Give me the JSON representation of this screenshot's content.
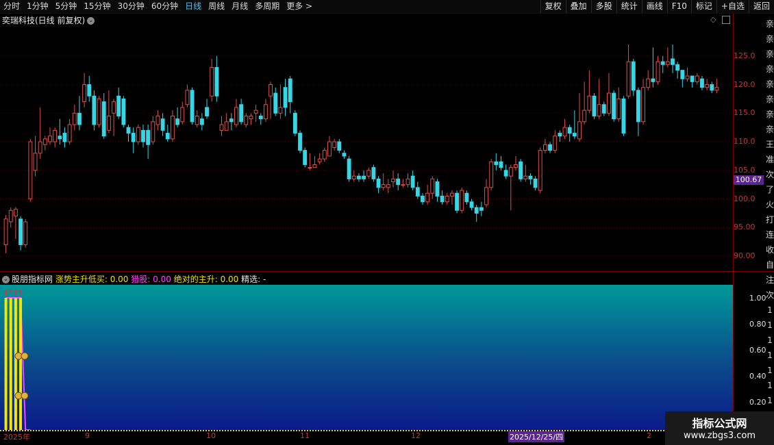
{
  "toolbar": {
    "periods": [
      "分时",
      "1分钟",
      "5分钟",
      "15分钟",
      "30分钟",
      "60分钟",
      "日线",
      "周线",
      "月线",
      "多周期",
      "更多 >"
    ],
    "active_period": "日线",
    "tools": [
      "复权",
      "叠加",
      "多股",
      "统计",
      "画线",
      "F10",
      "标记",
      "+自选",
      "返回"
    ]
  },
  "chart_title": "奕瑞科技(日线 前复权)",
  "price_axis": [
    "125.0",
    "120.0",
    "115.0",
    "110.0",
    "105.0",
    "100.0",
    "95.00",
    "90.00"
  ],
  "current_price": "100.67",
  "indicator": {
    "name": "股朋指标网",
    "f1_label": "涨势主升低买:",
    "f1_value": "0.00",
    "f2_label": "猎股:",
    "f2_value": "0.00",
    "f3_label": "绝对的主升:",
    "f3_value": "0.00",
    "f4_label": "精选:",
    "f4_value": "-",
    "axis": [
      "1.00",
      "0.80",
      "0.60",
      "0.40",
      "0.20"
    ]
  },
  "x_axis": [
    "2025年",
    "9",
    "10",
    "11",
    "12",
    "2"
  ],
  "current_date": "2025/12/25/四",
  "watermark": {
    "title": "指标公式网",
    "url": "www.zbgs3.com"
  },
  "colors": {
    "up": "#e0504a",
    "down": "#35d6e6",
    "axis": "#c03a3a",
    "highlight": "#5a2590"
  },
  "right_strip": [
    "亲",
    "亲",
    "亲",
    "亲",
    "亲",
    "亲",
    "亲",
    "亲",
    "王",
    "准",
    "次",
    "了",
    "火",
    "打",
    "连",
    "收",
    "自",
    "注",
    "次",
    "1",
    "1",
    "1",
    "1",
    "1",
    "1",
    "1",
    "1"
  ],
  "chart_data": {
    "type": "candlestick",
    "ylim": [
      87.5,
      130
    ],
    "candles": [
      [
        92.0,
        96.5,
        90.5,
        97.2
      ],
      [
        96.0,
        98.0,
        95.0,
        98.5
      ],
      [
        97.0,
        98.2,
        93.0,
        98.6
      ],
      [
        96.5,
        92.0,
        91.0,
        97.0
      ],
      [
        92.0,
        96.0,
        91.5,
        96.5
      ],
      [
        100.0,
        110.0,
        99.5,
        110.5
      ],
      [
        105.0,
        108.0,
        104.0,
        111.0
      ],
      [
        108.0,
        110.0,
        107.0,
        116.0
      ],
      [
        109.5,
        110.5,
        108.5,
        111.0
      ],
      [
        110.0,
        111.0,
        109.5,
        112.5
      ],
      [
        110.0,
        112.0,
        109.0,
        112.5
      ],
      [
        111.0,
        110.5,
        109.5,
        114.0
      ],
      [
        111.5,
        110.0,
        109.0,
        112.5
      ],
      [
        110.0,
        113.0,
        109.5,
        114.0
      ],
      [
        113.0,
        115.0,
        112.0,
        116.5
      ],
      [
        115.0,
        113.0,
        112.0,
        118.0
      ],
      [
        117.0,
        120.0,
        116.0,
        122.0
      ],
      [
        120.0,
        118.0,
        117.0,
        121.5
      ],
      [
        118.0,
        113.0,
        112.0,
        119.0
      ],
      [
        113.0,
        117.5,
        112.5,
        118.0
      ],
      [
        117.0,
        111.0,
        110.5,
        118.5
      ],
      [
        112.0,
        114.5,
        111.5,
        119.0
      ],
      [
        115.0,
        117.0,
        111.0,
        117.5
      ],
      [
        118.0,
        114.5,
        114.0,
        119.5
      ],
      [
        117.5,
        113.0,
        112.5,
        118.0
      ],
      [
        112.5,
        111.5,
        110.0,
        113.0
      ],
      [
        111.5,
        110.0,
        108.0,
        112.5
      ],
      [
        110.0,
        112.5,
        109.5,
        113.0
      ],
      [
        112.0,
        110.0,
        109.0,
        113.0
      ],
      [
        112.0,
        109.5,
        107.0,
        113.0
      ],
      [
        110.0,
        113.5,
        109.5,
        114.5
      ],
      [
        113.0,
        114.5,
        112.0,
        115.5
      ],
      [
        114.0,
        112.0,
        111.0,
        115.0
      ],
      [
        111.5,
        110.5,
        110.0,
        113.0
      ],
      [
        110.5,
        114.5,
        110.0,
        115.5
      ],
      [
        114.0,
        113.0,
        112.5,
        116.0
      ],
      [
        113.5,
        116.0,
        113.0,
        117.0
      ],
      [
        116.5,
        119.0,
        116.0,
        120.0
      ],
      [
        119.0,
        113.5,
        113.0,
        119.5
      ],
      [
        113.0,
        114.5,
        112.5,
        115.5
      ],
      [
        114.0,
        113.0,
        112.0,
        115.0
      ],
      [
        116.0,
        114.5,
        114.0,
        117.5
      ],
      [
        118.0,
        123.0,
        117.0,
        124.5
      ],
      [
        123.0,
        118.0,
        117.0,
        125.0
      ],
      [
        112.0,
        113.0,
        111.0,
        114.5
      ],
      [
        112.0,
        113.5,
        112.0,
        115.0
      ],
      [
        114.0,
        113.5,
        112.0,
        115.0
      ],
      [
        113.0,
        116.0,
        112.5,
        117.5
      ],
      [
        116.5,
        113.5,
        113.0,
        117.5
      ],
      [
        113.0,
        114.5,
        112.5,
        115.0
      ],
      [
        114.0,
        114.5,
        113.0,
        115.0
      ],
      [
        115.0,
        115.5,
        113.5,
        116.5
      ],
      [
        114.5,
        114.0,
        113.0,
        115.0
      ],
      [
        114.0,
        116.5,
        113.5,
        117.5
      ],
      [
        118.0,
        120.0,
        114.0,
        120.5
      ],
      [
        118.5,
        115.0,
        114.5,
        119.5
      ],
      [
        115.0,
        116.0,
        114.0,
        120.0
      ],
      [
        119.5,
        116.0,
        114.5,
        121.0
      ],
      [
        121.0,
        117.0,
        115.0,
        121.5
      ],
      [
        115.0,
        111.5,
        111.0,
        115.5
      ],
      [
        111.5,
        108.5,
        108.0,
        112.0
      ],
      [
        108.5,
        106.0,
        105.5,
        109.0
      ],
      [
        105.5,
        105.5,
        105.0,
        108.0
      ],
      [
        105.5,
        106.0,
        105.5,
        107.5
      ],
      [
        106.5,
        107.0,
        106.0,
        108.0
      ],
      [
        107.0,
        108.5,
        106.5,
        109.0
      ],
      [
        107.5,
        110.0,
        107.5,
        111.0
      ],
      [
        109.0,
        110.0,
        108.5,
        110.5
      ],
      [
        110.0,
        108.5,
        108.0,
        110.5
      ],
      [
        108.0,
        107.5,
        107.0,
        108.5
      ],
      [
        107.0,
        103.5,
        103.0,
        107.5
      ],
      [
        103.5,
        104.0,
        103.0,
        105.0
      ],
      [
        104.0,
        103.5,
        103.0,
        104.5
      ],
      [
        104.0,
        103.5,
        103.0,
        105.0
      ],
      [
        104.0,
        105.0,
        103.5,
        105.5
      ],
      [
        105.5,
        103.5,
        103.0,
        106.0
      ],
      [
        103.5,
        102.0,
        101.0,
        104.0
      ],
      [
        102.0,
        102.5,
        101.5,
        104.5
      ],
      [
        102.0,
        102.5,
        101.0,
        103.5
      ],
      [
        103.0,
        103.5,
        102.0,
        105.0
      ],
      [
        103.5,
        102.5,
        101.5,
        104.5
      ],
      [
        102.5,
        102.5,
        102.0,
        103.5
      ],
      [
        102.5,
        103.5,
        102.0,
        104.5
      ],
      [
        104.0,
        102.0,
        101.5,
        105.0
      ],
      [
        102.0,
        100.5,
        100.0,
        103.0
      ],
      [
        100.5,
        99.5,
        99.0,
        101.0
      ],
      [
        99.5,
        101.0,
        99.0,
        102.5
      ],
      [
        101.0,
        103.5,
        100.0,
        104.0
      ],
      [
        103.0,
        100.5,
        99.5,
        103.5
      ],
      [
        100.5,
        99.5,
        99.0,
        101.5
      ],
      [
        99.5,
        100.5,
        99.0,
        101.0
      ],
      [
        100.5,
        101.0,
        99.0,
        101.5
      ],
      [
        101.0,
        98.0,
        97.5,
        101.5
      ],
      [
        98.0,
        101.5,
        97.5,
        102.0
      ],
      [
        101.0,
        99.5,
        99.0,
        101.5
      ],
      [
        99.5,
        98.5,
        98.0,
        100.0
      ],
      [
        98.5,
        97.5,
        96.0,
        99.0
      ],
      [
        98.5,
        98.0,
        97.0,
        99.5
      ],
      [
        99.0,
        102.0,
        98.5,
        103.5
      ],
      [
        102.0,
        106.5,
        101.5,
        107.0
      ],
      [
        106.5,
        106.0,
        105.0,
        108.0
      ],
      [
        106.5,
        105.5,
        105.0,
        107.5
      ],
      [
        105.0,
        104.0,
        103.5,
        106.0
      ],
      [
        104.0,
        105.5,
        98.0,
        106.0
      ],
      [
        105.5,
        106.0,
        105.0,
        107.5
      ],
      [
        106.5,
        103.5,
        103.0,
        107.0
      ],
      [
        103.5,
        104.0,
        103.0,
        106.0
      ],
      [
        104.0,
        103.5,
        102.5,
        104.5
      ],
      [
        103.5,
        102.0,
        101.5,
        104.0
      ],
      [
        101.5,
        108.5,
        101.0,
        109.0
      ],
      [
        108.5,
        109.5,
        108.0,
        110.5
      ],
      [
        109.5,
        108.5,
        108.0,
        110.0
      ],
      [
        108.5,
        111.0,
        108.0,
        112.0
      ],
      [
        111.5,
        111.0,
        110.0,
        112.0
      ],
      [
        111.0,
        112.5,
        110.5,
        114.0
      ],
      [
        112.5,
        111.5,
        110.0,
        113.0
      ],
      [
        111.5,
        111.0,
        110.5,
        115.5
      ],
      [
        110.5,
        113.5,
        110.0,
        118.5
      ],
      [
        113.5,
        115.5,
        113.0,
        120.5
      ],
      [
        115.5,
        118.0,
        115.0,
        122.5
      ],
      [
        118.0,
        114.5,
        114.0,
        118.5
      ],
      [
        114.5,
        116.5,
        114.0,
        121.0
      ],
      [
        116.5,
        115.0,
        114.5,
        117.0
      ],
      [
        115.0,
        118.5,
        114.5,
        122.0
      ],
      [
        118.5,
        114.0,
        113.5,
        119.0
      ],
      [
        114.0,
        117.5,
        113.5,
        119.5
      ],
      [
        117.5,
        111.5,
        111.0,
        118.0
      ],
      [
        118.0,
        124.0,
        117.5,
        127.0
      ],
      [
        124.0,
        119.0,
        118.0,
        124.5
      ],
      [
        119.0,
        113.5,
        111.0,
        119.5
      ],
      [
        113.5,
        119.5,
        113.0,
        121.0
      ],
      [
        119.5,
        121.0,
        119.0,
        122.5
      ],
      [
        121.0,
        120.5,
        119.5,
        126.5
      ],
      [
        120.5,
        124.0,
        120.0,
        125.0
      ],
      [
        124.0,
        123.5,
        122.0,
        125.0
      ],
      [
        123.5,
        124.0,
        123.0,
        126.5
      ],
      [
        124.5,
        123.5,
        122.0,
        127.0
      ],
      [
        123.5,
        122.5,
        121.0,
        124.0
      ],
      [
        122.5,
        121.0,
        119.5,
        122.5
      ],
      [
        121.0,
        121.5,
        120.5,
        123.0
      ],
      [
        121.5,
        120.5,
        119.5,
        121.5
      ],
      [
        120.5,
        121.5,
        120.0,
        122.0
      ],
      [
        121.0,
        119.5,
        119.0,
        121.5
      ],
      [
        119.5,
        120.0,
        119.0,
        121.0
      ],
      [
        120.0,
        119.0,
        118.5,
        120.5
      ],
      [
        119.0,
        119.5,
        118.5,
        121.0
      ]
    ],
    "indicator_series": {
      "magenta": [
        1,
        1,
        1,
        1,
        0,
        0
      ],
      "yellow": [
        1,
        1,
        1,
        1,
        0,
        0
      ]
    }
  }
}
